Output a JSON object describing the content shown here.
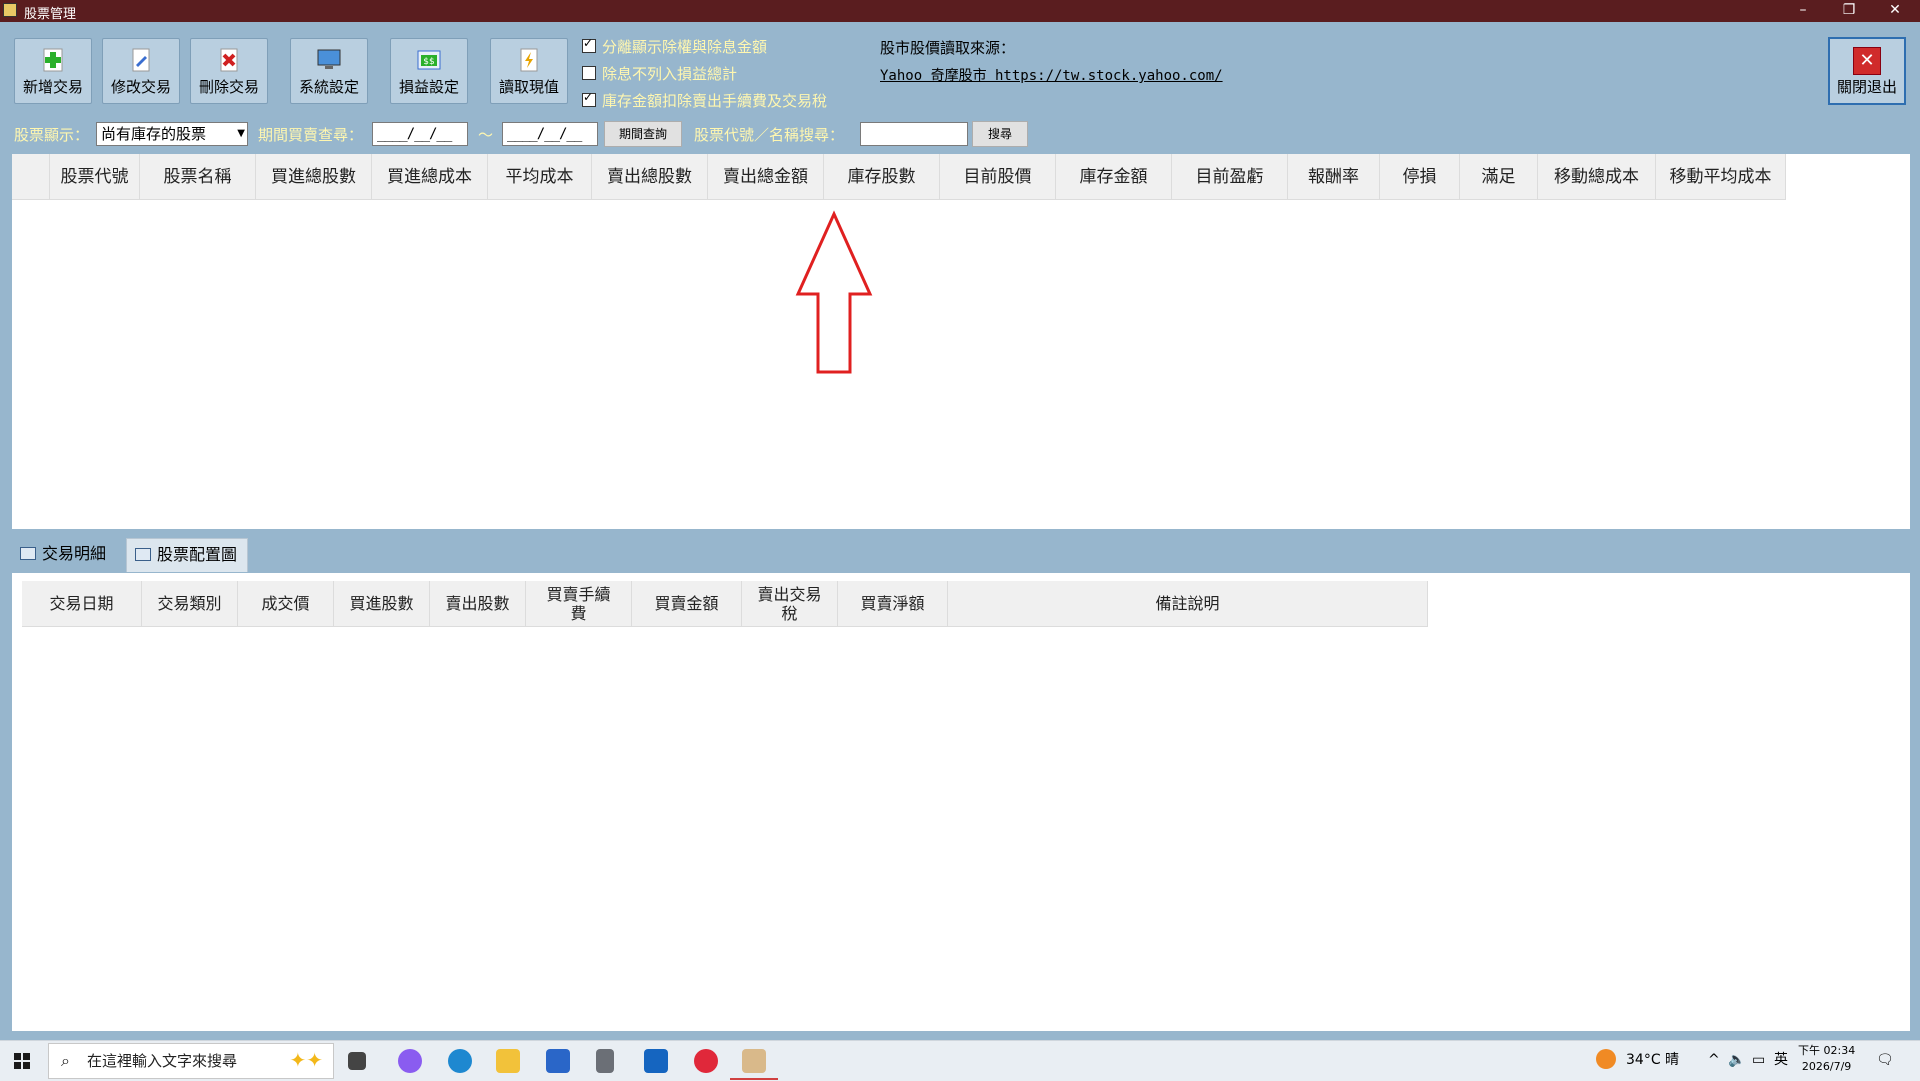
{
  "window": {
    "title": "股票管理",
    "minimize": "–",
    "restore": "❐",
    "close": "✕"
  },
  "toolbar": {
    "add": "新增交易",
    "edit": "修改交易",
    "delete": "刪除交易",
    "system": "系統設定",
    "profit": "損益設定",
    "read": "讀取現值",
    "exit": "關閉退出"
  },
  "options": [
    {
      "label": "分離顯示除權與除息金額",
      "checked": true
    },
    {
      "label": "除息不列入損益總計",
      "checked": false
    },
    {
      "label": "庫存金額扣除賣出手續費及交易稅",
      "checked": true
    }
  ],
  "source": {
    "label": "股市股價讀取來源：",
    "link": "Yahoo 奇摩股市 https://tw.stock.yahoo.com/"
  },
  "filter": {
    "display_label": "股票顯示：",
    "display_value": "尚有庫存的股票",
    "period_label": "期間買賣查尋：",
    "date_from": "____/__/__",
    "date_to": "____/__/__",
    "tilde": "～",
    "period_button": "期間查詢",
    "search_label": "股票代號／名稱搜尋：",
    "search_value": "",
    "search_button": "搜尋"
  },
  "stock_grid": {
    "columns": [
      "股票代號",
      "股票名稱",
      "買進總股數",
      "買進總成本",
      "平均成本",
      "賣出總股數",
      "賣出總金額",
      "庫存股數",
      "目前股價",
      "庫存金額",
      "目前盈虧",
      "報酬率",
      "停損",
      "滿足",
      "移動總成本",
      "移動平均成本"
    ]
  },
  "tabs": [
    {
      "label": "交易明細",
      "active": true
    },
    {
      "label": "股票配置圖",
      "active": false
    }
  ],
  "detail_grid": {
    "columns": [
      "交易日期",
      "交易類別",
      "成交價",
      "買進股數",
      "賣出股數",
      "買賣手續費",
      "買賣金額",
      "賣出交易稅",
      "買賣淨額",
      "備註說明"
    ]
  },
  "taskbar": {
    "search_placeholder": "在這裡輸入文字來搜尋",
    "weather": "34°C 晴",
    "ime": "英",
    "time": "下午 02:34",
    "date": "2026/7/9"
  },
  "colors": {
    "titlebar": "#5a1d1f",
    "background": "#97b6cd",
    "checkbox_text": "#fff7b0",
    "arrow": "#e02020"
  }
}
